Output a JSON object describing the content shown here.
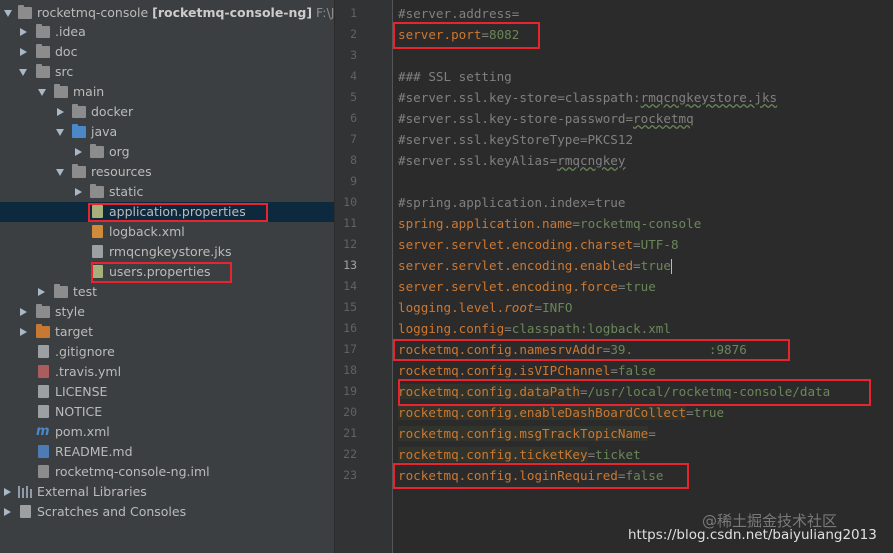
{
  "project_tree": {
    "root": {
      "name": "rocketmq-console",
      "module": "[rocketmq-console-ng]",
      "path": "F:\\Javal"
    },
    "items": [
      {
        "label": "rocketmq-console",
        "type": "root"
      },
      {
        "label": ".idea",
        "type": "folder"
      },
      {
        "label": "doc",
        "type": "folder"
      },
      {
        "label": "src",
        "type": "folder"
      },
      {
        "label": "main",
        "type": "folder"
      },
      {
        "label": "docker",
        "type": "folder"
      },
      {
        "label": "java",
        "type": "folder-source"
      },
      {
        "label": "org",
        "type": "package"
      },
      {
        "label": "resources",
        "type": "folder-resources"
      },
      {
        "label": "static",
        "type": "folder"
      },
      {
        "label": "application.properties",
        "type": "file-properties",
        "selected": true
      },
      {
        "label": "logback.xml",
        "type": "file-xml"
      },
      {
        "label": "rmqcngkeystore.jks",
        "type": "file"
      },
      {
        "label": "users.properties",
        "type": "file-properties"
      },
      {
        "label": "test",
        "type": "folder"
      },
      {
        "label": "style",
        "type": "folder"
      },
      {
        "label": "target",
        "type": "folder-excluded"
      },
      {
        "label": ".gitignore",
        "type": "file"
      },
      {
        "label": ".travis.yml",
        "type": "file-yml"
      },
      {
        "label": "LICENSE",
        "type": "file"
      },
      {
        "label": "NOTICE",
        "type": "file"
      },
      {
        "label": "pom.xml",
        "type": "file-maven"
      },
      {
        "label": "README.md",
        "type": "file-md"
      },
      {
        "label": "rocketmq-console-ng.iml",
        "type": "file-iml"
      },
      {
        "label": "External Libraries",
        "type": "libraries"
      },
      {
        "label": "Scratches and Consoles",
        "type": "scratches"
      }
    ]
  },
  "editor": {
    "current_line": 13,
    "lines": [
      {
        "n": "1",
        "key": "#server.address=",
        "val": "",
        "comment": true
      },
      {
        "n": "2",
        "key": "server.port",
        "val": "8082"
      },
      {
        "n": "3",
        "key": "",
        "val": ""
      },
      {
        "n": "4",
        "key": "### SSL setting",
        "val": "",
        "comment": true
      },
      {
        "n": "5",
        "key": "#server.ssl.key-store=classpath:",
        "val": "rmqcngkeystore.jks",
        "comment": true
      },
      {
        "n": "6",
        "key": "#server.ssl.key-store-password=",
        "val": "rocketmq",
        "comment": true
      },
      {
        "n": "7",
        "key": "#server.ssl.keyStoreType=PKCS12",
        "val": "",
        "comment": true
      },
      {
        "n": "8",
        "key": "#server.ssl.keyAlias=",
        "val": "rmqcngkey",
        "comment": true
      },
      {
        "n": "9",
        "key": "",
        "val": ""
      },
      {
        "n": "10",
        "key": "#spring.application.index=true",
        "val": "",
        "comment": true
      },
      {
        "n": "11",
        "key": "spring.application.name",
        "val": "rocketmq-console"
      },
      {
        "n": "12",
        "key": "server.servlet.encoding.charset",
        "val": "UTF-8"
      },
      {
        "n": "13",
        "key": "server.servlet.encoding.enabled",
        "val": "true"
      },
      {
        "n": "14",
        "key": "server.servlet.encoding.force",
        "val": "true"
      },
      {
        "n": "15",
        "key": "logging.level.",
        "key_italic": "root",
        "val": "INFO"
      },
      {
        "n": "16",
        "key": "logging.config",
        "val": "classpath:logback.xml"
      },
      {
        "n": "17",
        "key": "rocketmq.config.namesrvAddr",
        "val": "39.",
        "val_tail": ":9876"
      },
      {
        "n": "18",
        "key": "rocketmq.config.isVIPChannel",
        "val": "false"
      },
      {
        "n": "19",
        "key": "rocketmq.config.dataPath",
        "val": "/usr/local/rocketmq-console/data"
      },
      {
        "n": "20",
        "key": "rocketmq.config.enableDashBoardCollect",
        "val": "true"
      },
      {
        "n": "21",
        "key": "rocketmq.config.msgTrackTopicName",
        "val": ""
      },
      {
        "n": "22",
        "key": "rocketmq.config.ticketKey",
        "val": "ticket"
      },
      {
        "n": "23",
        "key": "rocketmq.config.loginRequired",
        "val": "false"
      }
    ]
  },
  "watermark": {
    "text": "https://blog.csdn.net/baiyuliang2013",
    "site": "@稀土掘金技术社区"
  },
  "colors": {
    "highlight_box": "#e8252f",
    "key": "#cc7832",
    "value": "#6a8759",
    "comment": "#808080",
    "selection": "#0d293e"
  }
}
